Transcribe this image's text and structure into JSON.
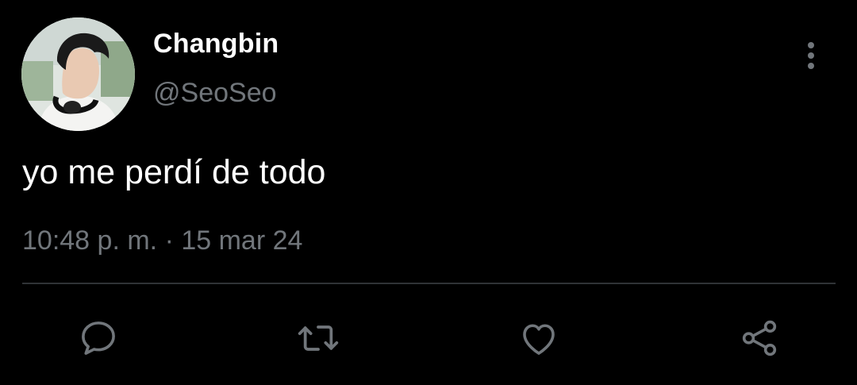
{
  "author": {
    "display_name": "Changbin",
    "handle": "@SeoSeo",
    "avatar_icon": "profile-photo"
  },
  "tweet": {
    "text": "yo me perdí de todo",
    "time": "10:48 p. m.",
    "separator": "·",
    "date": "15 mar 24"
  },
  "actions": {
    "reply_icon": "reply-icon",
    "retweet_icon": "retweet-icon",
    "like_icon": "heart-icon",
    "share_icon": "share-icon",
    "more_icon": "more-vertical-icon"
  },
  "colors": {
    "background": "#000000",
    "primary_text": "#ffffff",
    "secondary_text": "#71767b",
    "divider": "#2f3336"
  }
}
